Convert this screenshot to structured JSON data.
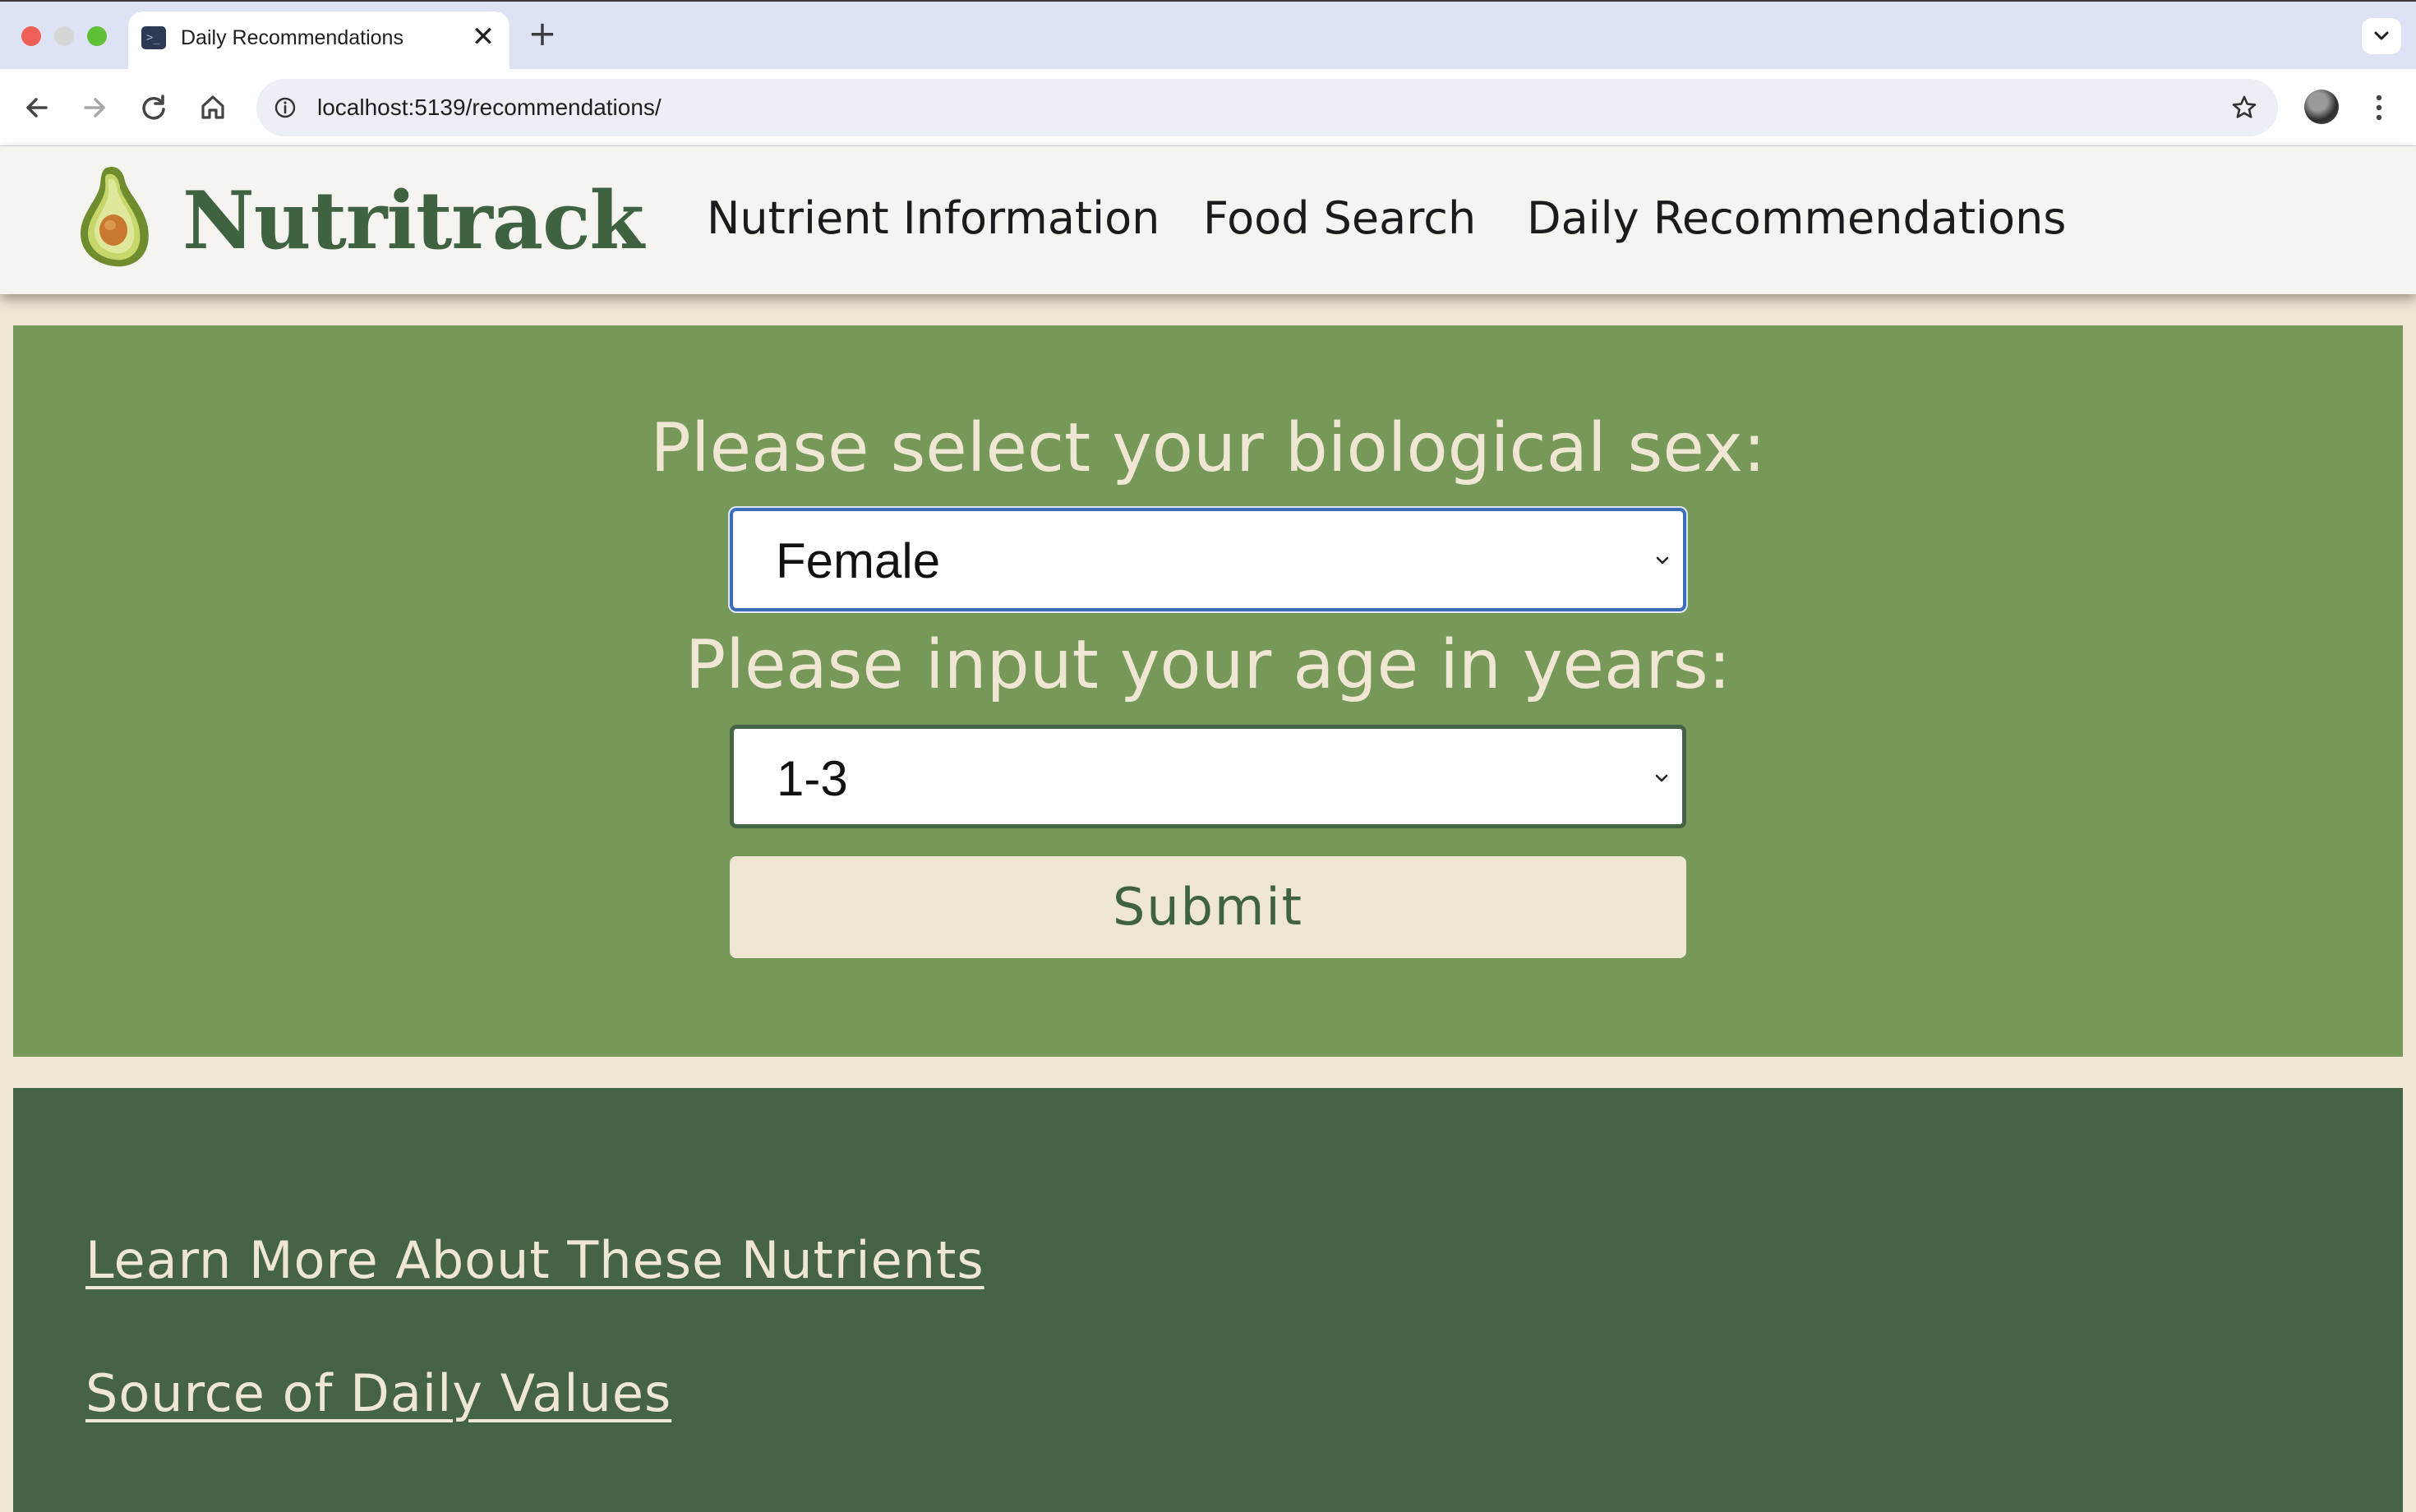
{
  "browser": {
    "tab_title": "Daily Recommendations",
    "tab_close": "✕",
    "new_tab": "+",
    "url": "localhost:5139/recommendations/",
    "favicon_text": ">_"
  },
  "site": {
    "brand": "Nutritrack",
    "logo_icon": "avocado-icon",
    "nav": [
      {
        "label": "Nutrient Information"
      },
      {
        "label": "Food Search"
      },
      {
        "label": "Daily Recommendations"
      }
    ]
  },
  "form": {
    "sex_label": "Please select your biological sex:",
    "sex_value": "Female",
    "age_label": "Please input your age in years:",
    "age_value": "1-3",
    "submit_label": "Submit"
  },
  "footer": {
    "links": [
      {
        "label": "Learn More About These Nutrients"
      },
      {
        "label": "Source of Daily Values"
      }
    ]
  },
  "colors": {
    "panel_green": "#769858",
    "footer_green": "#446445",
    "cream": "#efe6d4",
    "brand_green": "#3f6240"
  }
}
